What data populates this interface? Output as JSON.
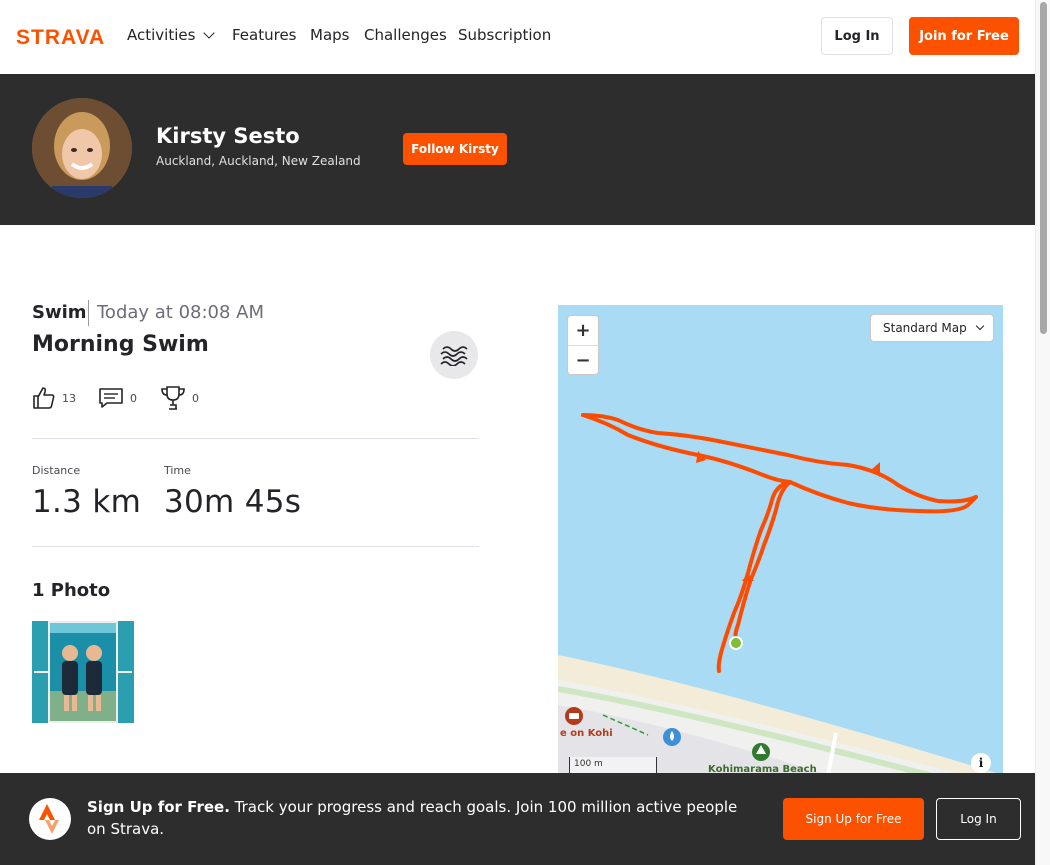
{
  "nav": {
    "logo_text": "STRAVA",
    "items": [
      {
        "label": "Activities"
      },
      {
        "label": "Features"
      },
      {
        "label": "Maps"
      },
      {
        "label": "Challenges"
      },
      {
        "label": "Subscription"
      }
    ],
    "login_label": "Log In",
    "join_label": "Join for Free"
  },
  "athlete": {
    "name": "Kirsty Sesto",
    "location": "Auckland, Auckland, New Zealand",
    "follow_label": "Follow Kirsty"
  },
  "activity": {
    "sport": "Swim",
    "date": "Today at 08:08 AM",
    "title": "Morning Swim",
    "kudos_count": "13",
    "comments_count": "0",
    "achievements_count": "0",
    "stats": [
      {
        "label": "Distance",
        "value": "1.3 km"
      },
      {
        "label": "Time",
        "value": "30m 45s"
      }
    ],
    "photos_title": "1 Photo"
  },
  "map": {
    "zoom_in": "+",
    "zoom_out": "−",
    "map_type": "Standard Map",
    "scale_label": "100 m",
    "place_labels": [
      "e on Kohi",
      "Kohimarama Beach"
    ],
    "info_label": "i"
  },
  "banner": {
    "headline": "Sign Up for Free.",
    "text": " Track your progress and reach goals. Join 100 million active people on Strava.",
    "signup_label": "Sign Up for Free",
    "login_label": "Log In"
  },
  "colors": {
    "brand": "#fc5200",
    "dark_band": "#2d2d2d",
    "water": "#a9dbf4"
  }
}
